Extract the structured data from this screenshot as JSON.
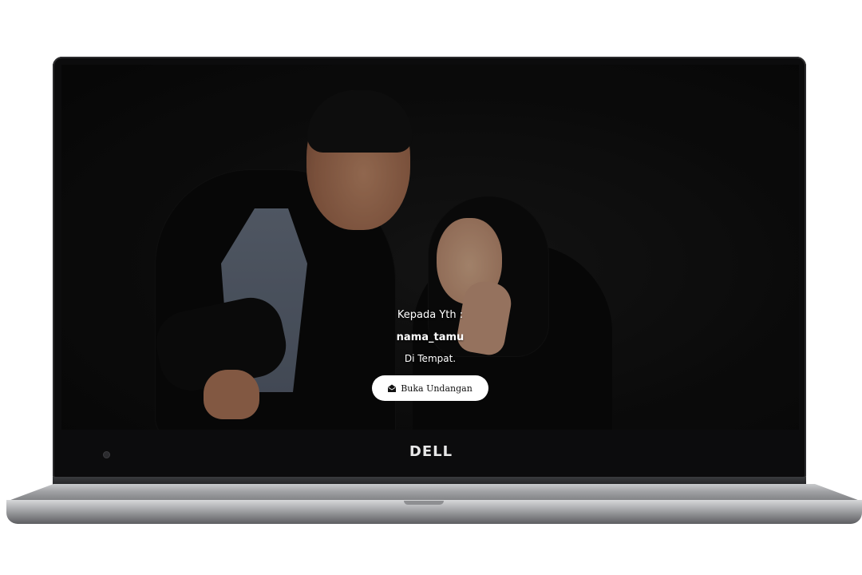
{
  "invitation": {
    "greeting": "Kepada Yth :",
    "guest_name": "nama_tamu",
    "location": "Di Tempat.",
    "open_button_label": "Buka Undangan",
    "open_button_icon": "envelope-open-icon"
  },
  "device": {
    "brand_label": "DELL"
  },
  "colors": {
    "overlay_text": "#ffffff",
    "button_bg": "#ffffff",
    "button_text": "#111111",
    "bezel": "#0c0c0d"
  }
}
